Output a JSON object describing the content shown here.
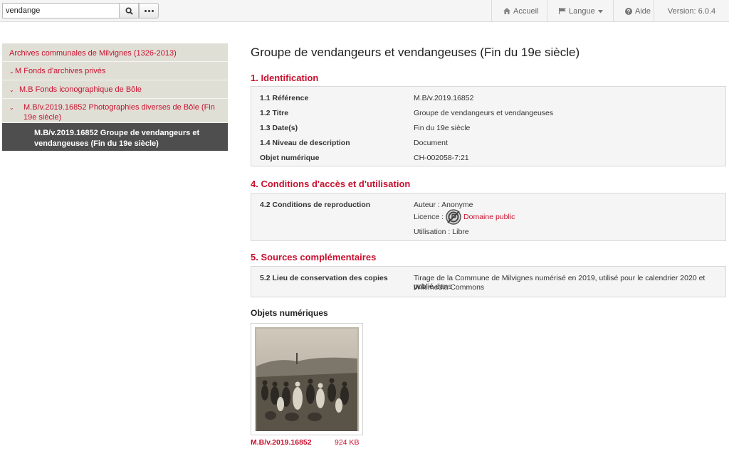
{
  "search": {
    "value": "vendange"
  },
  "nav": {
    "accueil": "Accueil",
    "langue": "Langue",
    "aide": "Aide",
    "version": "Version: 6.0.4"
  },
  "tree": {
    "items": [
      {
        "label": "Archives communales de Milvignes (1326-2013)"
      },
      {
        "label": "M Fonds d'archives privés"
      },
      {
        "label": "M.B Fonds iconographique de Bôle"
      },
      {
        "label": "M.B/v.2019.16852 Photographies diverses de Bôle (Fin 19e siècle)"
      }
    ],
    "active": "M.B/v.2019.16852 Groupe de vendangeurs et vendangeuses (Fin du 19e siècle)"
  },
  "main": {
    "title": "Groupe de vendangeurs et vendangeuses (Fin du 19e siècle)",
    "identification": {
      "title": "1. Identification",
      "rows": [
        {
          "label": "1.1 Référence",
          "value": "M.B/v.2019.16852"
        },
        {
          "label": "1.2 Titre",
          "value": "Groupe de vendangeurs et vendangeuses"
        },
        {
          "label": "1.3 Date(s)",
          "value": "Fin du 19e siècle"
        },
        {
          "label": "1.4 Niveau de description",
          "value": "Document"
        },
        {
          "label": "Objet numérique",
          "value": "CH-002058-7:21"
        }
      ]
    },
    "conditions": {
      "title": "4. Conditions d'accès et d'utilisation",
      "label": "4.2 Conditions de reproduction",
      "auteur": "Auteur : Anonyme",
      "licence_prefix": "Licence :",
      "licence_link": "Domaine public",
      "utilisation": "Utilisation : Libre"
    },
    "sources": {
      "title": "5. Sources complémentaires",
      "label": "5.2 Lieu de conservation des copies",
      "value_line1": "Tirage de la Commune de Milvignes numérisé en 2019, utilisé pour le calendrier 2020 et publié dans",
      "value_line2": "Wikimedia Commons"
    },
    "objets": {
      "title": "Objets numériques",
      "id": "M.B/v.2019.16852",
      "size": "924 KB"
    }
  },
  "colors": {
    "accent": "#c8102e",
    "tree_bg": "#e0dfd6",
    "active_bg": "#4e4e4e"
  }
}
